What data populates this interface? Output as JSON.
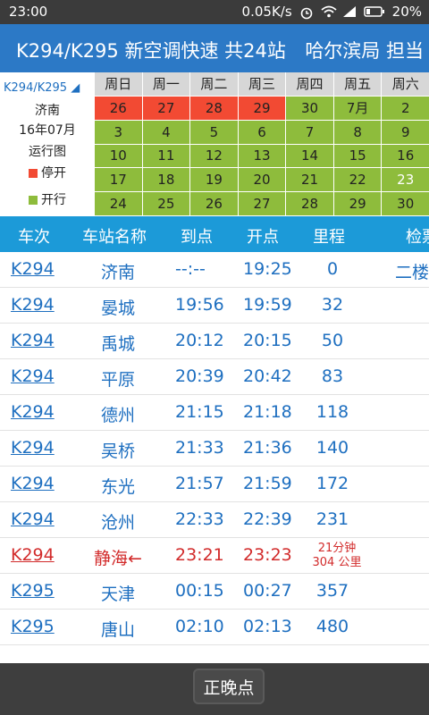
{
  "status": {
    "time": "23:00",
    "speed": "0.05K/s",
    "battery": "20%"
  },
  "title": {
    "main": "K294/K295 新空调快速 共24站",
    "bureau": "哈尔滨局 担当"
  },
  "calendar": {
    "label_train": "K294/K295",
    "label_station": "济南",
    "label_month": "16年07月",
    "label_chart": "运行图",
    "legend_stop": "停开",
    "legend_run": "开行",
    "headers": [
      "周日",
      "周一",
      "周二",
      "周三",
      "周四",
      "周五",
      "周六"
    ],
    "rows": [
      [
        {
          "d": "26",
          "s": "r"
        },
        {
          "d": "27",
          "s": "r"
        },
        {
          "d": "28",
          "s": "r"
        },
        {
          "d": "29",
          "s": "r"
        },
        {
          "d": "30",
          "s": "g"
        },
        {
          "d": "7月",
          "s": "g"
        },
        {
          "d": "2",
          "s": "g"
        }
      ],
      [
        {
          "d": "3",
          "s": "g"
        },
        {
          "d": "4",
          "s": "g"
        },
        {
          "d": "5",
          "s": "g"
        },
        {
          "d": "6",
          "s": "g"
        },
        {
          "d": "7",
          "s": "g"
        },
        {
          "d": "8",
          "s": "g"
        },
        {
          "d": "9",
          "s": "g"
        }
      ],
      [
        {
          "d": "10",
          "s": "g"
        },
        {
          "d": "11",
          "s": "g"
        },
        {
          "d": "12",
          "s": "g"
        },
        {
          "d": "13",
          "s": "g"
        },
        {
          "d": "14",
          "s": "g"
        },
        {
          "d": "15",
          "s": "g"
        },
        {
          "d": "16",
          "s": "g"
        }
      ],
      [
        {
          "d": "17",
          "s": "g"
        },
        {
          "d": "18",
          "s": "g"
        },
        {
          "d": "19",
          "s": "g"
        },
        {
          "d": "20",
          "s": "g"
        },
        {
          "d": "21",
          "s": "g"
        },
        {
          "d": "22",
          "s": "g"
        },
        {
          "d": "23",
          "s": "g"
        }
      ],
      [
        {
          "d": "24",
          "s": "g"
        },
        {
          "d": "25",
          "s": "g"
        },
        {
          "d": "26",
          "s": "g"
        },
        {
          "d": "27",
          "s": "g"
        },
        {
          "d": "28",
          "s": "g"
        },
        {
          "d": "29",
          "s": "g"
        },
        {
          "d": "30",
          "s": "g"
        }
      ]
    ]
  },
  "table": {
    "headers": {
      "train": "车次",
      "station": "车站名称",
      "arrive": "到点",
      "depart": "开点",
      "km": "里程",
      "gate": "检票"
    },
    "rows": [
      {
        "train": "K294",
        "station": "济南",
        "arrive": "--:--",
        "depart": "19:25",
        "km": "0",
        "gate": "二楼"
      },
      {
        "train": "K294",
        "station": "晏城",
        "arrive": "19:56",
        "depart": "19:59",
        "km": "32",
        "gate": ""
      },
      {
        "train": "K294",
        "station": "禹城",
        "arrive": "20:12",
        "depart": "20:15",
        "km": "50",
        "gate": ""
      },
      {
        "train": "K294",
        "station": "平原",
        "arrive": "20:39",
        "depart": "20:42",
        "km": "83",
        "gate": ""
      },
      {
        "train": "K294",
        "station": "德州",
        "arrive": "21:15",
        "depart": "21:18",
        "km": "118",
        "gate": ""
      },
      {
        "train": "K294",
        "station": "吴桥",
        "arrive": "21:33",
        "depart": "21:36",
        "km": "140",
        "gate": ""
      },
      {
        "train": "K294",
        "station": "东光",
        "arrive": "21:57",
        "depart": "21:59",
        "km": "172",
        "gate": ""
      },
      {
        "train": "K294",
        "station": "沧州",
        "arrive": "22:33",
        "depart": "22:39",
        "km": "231",
        "gate": ""
      },
      {
        "train": "K294",
        "station": "静海←",
        "arrive": "23:21",
        "depart": "23:23",
        "km": "",
        "gate": "",
        "delay1": "21分钟",
        "delay2": "304 公里",
        "active": true
      },
      {
        "train": "K295",
        "station": "天津",
        "arrive": "00:15",
        "depart": "00:27",
        "km": "357",
        "gate": ""
      },
      {
        "train": "K295",
        "station": "唐山",
        "arrive": "02:10",
        "depart": "02:13",
        "km": "480",
        "gate": ""
      }
    ]
  },
  "bottom": {
    "button": "正晚点"
  },
  "colors": {
    "title_bg": "#2c79c6",
    "head_bg": "#1c9ad8",
    "stop": "#f24a33",
    "run": "#8ebc3c"
  }
}
